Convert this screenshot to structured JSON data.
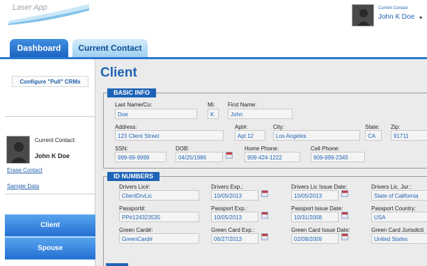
{
  "header": {
    "logo_text": "Laser App",
    "cc_label": "Current Contact",
    "cc_name": "John K Doe",
    "caret": "▾"
  },
  "tabs": {
    "dashboard": "Dashboard",
    "current_contact": "Current Contact"
  },
  "sidebar": {
    "configure_btn": "Configure \"Pull\" CRMs",
    "cc_label": "Current Contact:",
    "cc_name": "John K Doe",
    "erase": "Erase Contact",
    "sample": "Sample Data",
    "nav": [
      "Client",
      "Spouse"
    ]
  },
  "main": {
    "title": "Client"
  },
  "basic": {
    "title": "BASIC INFO",
    "labels": {
      "last": "Last Name/Co:",
      "mi": "Mi:",
      "first": "First Name:",
      "address": "Address:",
      "apt": "Apt#:",
      "city": "City:",
      "state": "State:",
      "zip": "Zip:",
      "ssn": "SSN:",
      "dob": "DOB:",
      "home": "Home Phone:",
      "cell": "Cell Phone:"
    },
    "values": {
      "last": "Doe",
      "mi": "K",
      "first": "John",
      "address": "123 Client Street",
      "apt": "Apt 12",
      "city": "Los Angeles",
      "state": "CA",
      "zip": "91711",
      "ssn": "999-99-9999",
      "dob": "04/25/1986",
      "home": "909-424-1222",
      "cell": "909-999-2345"
    }
  },
  "ids": {
    "title": "ID NUMBERS",
    "labels": {
      "dl": "Drivers Lic#:",
      "dl_exp": "Drivers Exp.:",
      "dl_issue": "Drivers Lic Issue Date:",
      "dl_jur": "Drivers Lic. Jur.:",
      "pp": "Passport#:",
      "pp_exp": "Passport Exp.:",
      "pp_issue": "Passport Issue Date:",
      "pp_country": "Passport Country:",
      "gc": "Green Card#:",
      "gc_exp": "Green Card Exp.:",
      "gc_issue": "Green Card Issue Date:",
      "gc_jur": "Green Card Jurisdicti"
    },
    "values": {
      "dl": "ClientDrvLic",
      "dl_exp": "10/05/2013",
      "dl_issue": "10/05/2013",
      "dl_jur": "State of California",
      "pp": "PP#124323535",
      "pp_exp": "10/05/2013",
      "pp_issue": "10/31/2008",
      "pp_country": "USA",
      "gc": "GreenCard#",
      "gc_exp": "06/27/2013",
      "gc_issue": "02/08/2009",
      "gc_jur": "United States"
    }
  }
}
